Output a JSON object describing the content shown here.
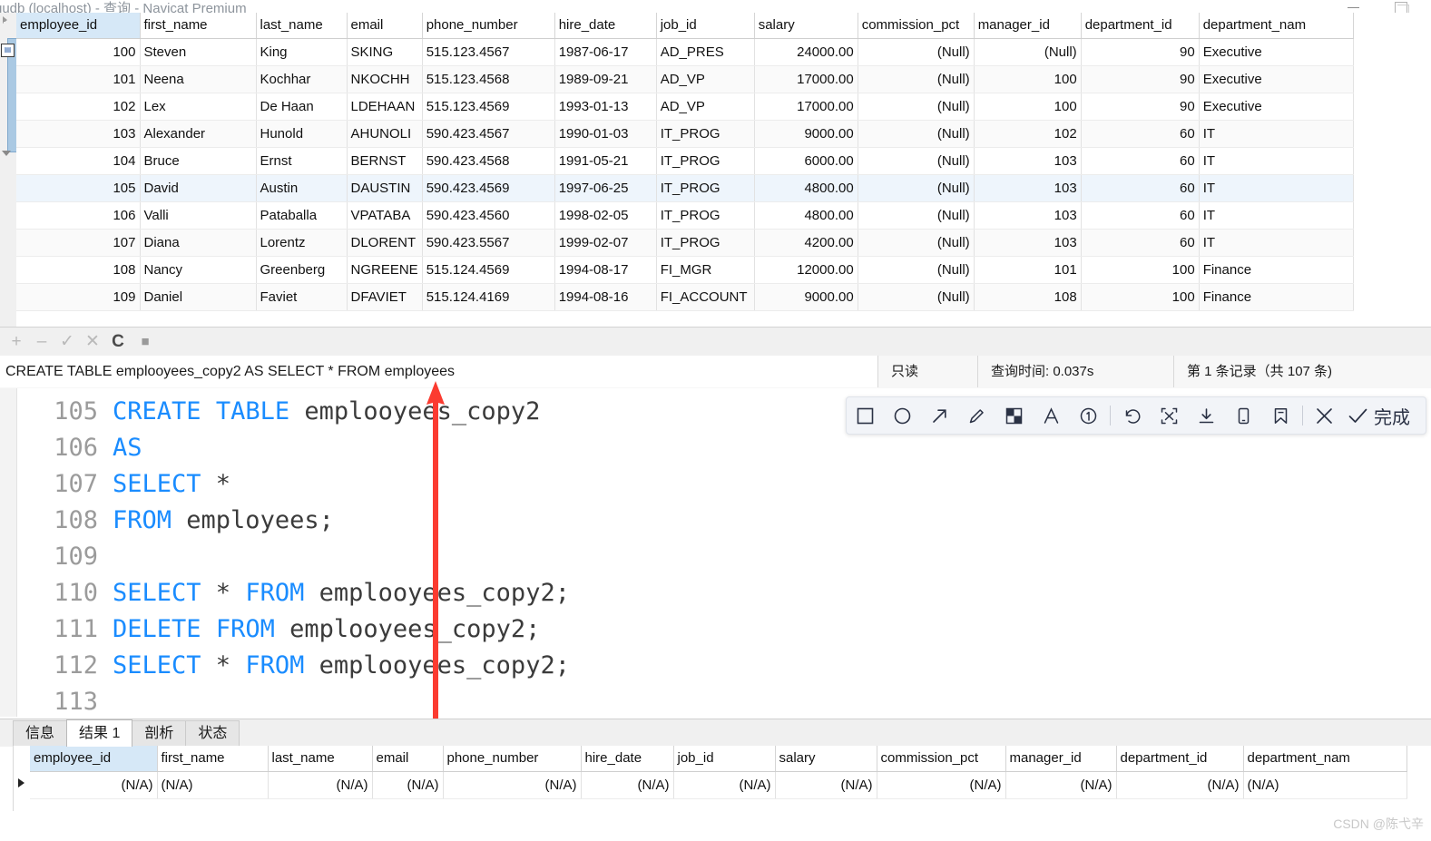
{
  "window": {
    "title": "gudb (localhost) - 查询 - Navicat Premium",
    "minimize": "–",
    "maximize": "□"
  },
  "top_grid": {
    "columns": [
      "employee_id",
      "first_name",
      "last_name",
      "email",
      "phone_number",
      "hire_date",
      "job_id",
      "salary",
      "commission_pct",
      "manager_id",
      "department_id",
      "department_nam"
    ],
    "null_label": "(Null)",
    "rows": [
      [
        "100",
        "Steven",
        "King",
        "SKING",
        "515.123.4567",
        "1987-06-17",
        "AD_PRES",
        "24000.00",
        "(Null)",
        "(Null)",
        "90",
        "Executive"
      ],
      [
        "101",
        "Neena",
        "Kochhar",
        "NKOCHH",
        "515.123.4568",
        "1989-09-21",
        "AD_VP",
        "17000.00",
        "(Null)",
        "100",
        "90",
        "Executive"
      ],
      [
        "102",
        "Lex",
        "De Haan",
        "LDEHAAN",
        "515.123.4569",
        "1993-01-13",
        "AD_VP",
        "17000.00",
        "(Null)",
        "100",
        "90",
        "Executive"
      ],
      [
        "103",
        "Alexander",
        "Hunold",
        "AHUNOLI",
        "590.423.4567",
        "1990-01-03",
        "IT_PROG",
        "9000.00",
        "(Null)",
        "102",
        "60",
        "IT"
      ],
      [
        "104",
        "Bruce",
        "Ernst",
        "BERNST",
        "590.423.4568",
        "1991-05-21",
        "IT_PROG",
        "6000.00",
        "(Null)",
        "103",
        "60",
        "IT"
      ],
      [
        "105",
        "David",
        "Austin",
        "DAUSTIN",
        "590.423.4569",
        "1997-06-25",
        "IT_PROG",
        "4800.00",
        "(Null)",
        "103",
        "60",
        "IT"
      ],
      [
        "106",
        "Valli",
        "Pataballa",
        "VPATABA",
        "590.423.4560",
        "1998-02-05",
        "IT_PROG",
        "4800.00",
        "(Null)",
        "103",
        "60",
        "IT"
      ],
      [
        "107",
        "Diana",
        "Lorentz",
        "DLORENT",
        "590.423.5567",
        "1999-02-07",
        "IT_PROG",
        "4200.00",
        "(Null)",
        "103",
        "60",
        "IT"
      ],
      [
        "108",
        "Nancy",
        "Greenberg",
        "NGREENE",
        "515.124.4569",
        "1994-08-17",
        "FI_MGR",
        "12000.00",
        "(Null)",
        "101",
        "100",
        "Finance"
      ],
      [
        "109",
        "Daniel",
        "Faviet",
        "DFAVIET",
        "515.124.4169",
        "1994-08-16",
        "FI_ACCOUNT",
        "9000.00",
        "(Null)",
        "108",
        "100",
        "Finance"
      ]
    ]
  },
  "record_toolbar": {
    "add": "+",
    "remove": "–",
    "confirm": "✓",
    "cancel": "✕",
    "refresh": "C",
    "stop": "■"
  },
  "statusbar": {
    "query": "CREATE TABLE emplooyees_copy2 AS SELECT * FROM employees",
    "readonly": "只读",
    "query_time": "查询时间: 0.037s",
    "record_count": "第 1 条记录（共 107 条)"
  },
  "editor": {
    "lines": [
      {
        "no": "105",
        "tokens": [
          {
            "t": "CREATE",
            "k": "kw"
          },
          {
            "t": " ",
            "k": "pun"
          },
          {
            "t": "TABLE",
            "k": "kw"
          },
          {
            "t": " emplooyees_copy2",
            "k": "idf"
          }
        ]
      },
      {
        "no": "106",
        "tokens": [
          {
            "t": "AS",
            "k": "kw"
          }
        ]
      },
      {
        "no": "107",
        "tokens": [
          {
            "t": "SELECT",
            "k": "kw"
          },
          {
            "t": " *",
            "k": "idf"
          }
        ]
      },
      {
        "no": "108",
        "tokens": [
          {
            "t": "FROM",
            "k": "kw"
          },
          {
            "t": " employees;",
            "k": "idf"
          }
        ]
      },
      {
        "no": "109",
        "tokens": []
      },
      {
        "no": "110",
        "tokens": [
          {
            "t": "SELECT",
            "k": "kw"
          },
          {
            "t": " * ",
            "k": "idf"
          },
          {
            "t": "FROM",
            "k": "kw"
          },
          {
            "t": " emplooyees_copy2;",
            "k": "idf"
          }
        ]
      },
      {
        "no": "111",
        "tokens": [
          {
            "t": "DELETE",
            "k": "kw"
          },
          {
            "t": " ",
            "k": "pun"
          },
          {
            "t": "FROM",
            "k": "kw"
          },
          {
            "t": " emplooyees_copy2;",
            "k": "idf"
          }
        ]
      },
      {
        "no": "112",
        "tokens": [
          {
            "t": "SELECT",
            "k": "kw"
          },
          {
            "t": " * ",
            "k": "idf"
          },
          {
            "t": "FROM",
            "k": "kw"
          },
          {
            "t": " emplooyees_copy2;",
            "k": "idf"
          }
        ]
      },
      {
        "no": "113",
        "tokens": []
      }
    ]
  },
  "annotation_toolbar": {
    "tools": [
      "rectangle-icon",
      "ellipse-icon",
      "arrow-icon",
      "pen-icon",
      "mosaic-icon",
      "text-icon",
      "number-icon",
      "undo-icon",
      "ocr-icon",
      "download-icon",
      "pin-phone-icon",
      "save-icon",
      "close-icon",
      "check-icon"
    ],
    "done_label": "完成"
  },
  "annotation_shape": {
    "type": "double-headed-arrow",
    "color": "#fb3b30"
  },
  "bottom_tabs": {
    "items": [
      "信息",
      "结果 1",
      "剖析",
      "状态"
    ],
    "active_index": 1
  },
  "bottom_grid": {
    "columns": [
      "employee_id",
      "first_name",
      "last_name",
      "email",
      "phone_number",
      "hire_date",
      "job_id",
      "salary",
      "commission_pct",
      "manager_id",
      "department_id",
      "department_nam"
    ],
    "na_label": "(N/A)",
    "rows": [
      [
        "(N/A)",
        "(N/A)",
        "(N/A)",
        "(N/A)",
        "(N/A)",
        "(N/A)",
        "(N/A)",
        "(N/A)",
        "(N/A)",
        "(N/A)",
        "(N/A)",
        "(N/A)"
      ]
    ]
  },
  "watermark": "CSDN @陈弋辛"
}
